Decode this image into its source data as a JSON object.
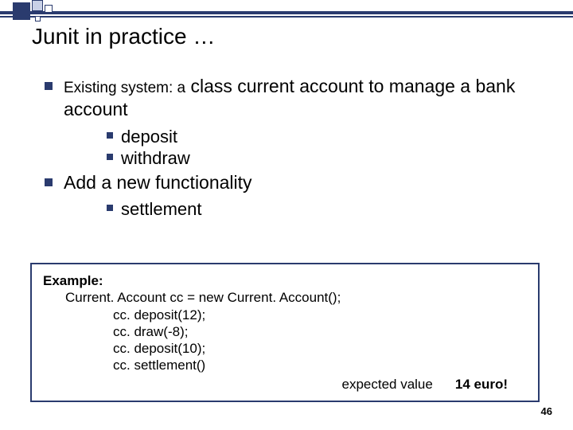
{
  "title": "Junit in practice …",
  "bullets": {
    "existing_lead": "Existing system: a",
    "existing_main": " class current account to manage a bank account",
    "sub_deposit": "deposit",
    "sub_withdraw": "withdraw",
    "add_func": "Add a new functionality",
    "sub_settlement": "settlement"
  },
  "example": {
    "header": "Example:",
    "line1": "Current. Account cc = new Current. Account();",
    "line2": "cc. deposit(12);",
    "line3": "cc. draw(-8);",
    "line4": "cc. deposit(10);",
    "line5": "cc. settlement()",
    "expected_label": "expected value",
    "expected_value": "14 euro!"
  },
  "page_number": "46"
}
